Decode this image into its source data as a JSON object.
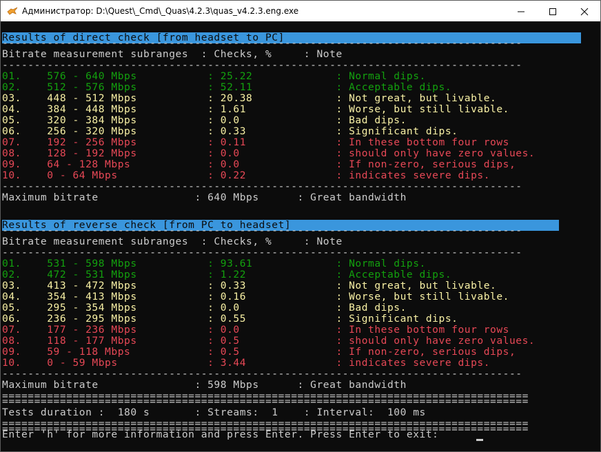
{
  "window": {
    "title": "Администратор: D:\\Quest\\_Cmd\\_Quas\\4.2.3\\quas_v4.2.3.eng.exe",
    "icon": "quas-app-icon",
    "controls": [
      "minimize-icon",
      "maximize-icon",
      "close-icon"
    ]
  },
  "colors": {
    "background": "#0c0c0c",
    "text": "#cccccc",
    "header_bar": "#3a96dd",
    "green": "#13a10e",
    "yellow": "#f9f1a5",
    "red": "#e74856"
  },
  "lines": {
    "dash": "---------------------------------------------------------------------------------",
    "equals": "=================================================================================="
  },
  "direct": {
    "header": "Results of direct check [from headset to PC]",
    "columns": "Bitrate measurement subranges  : Checks, %     : Note",
    "rows": [
      {
        "text": "01.    576 - 640 Mbps           : 25.22             : Normal dips.",
        "color": "green"
      },
      {
        "text": "02.    512 - 576 Mbps           : 52.11             : Acceptable dips.",
        "color": "green"
      },
      {
        "text": "03.    448 - 512 Mbps           : 20.38             : Not great, but livable.",
        "color": "yellow"
      },
      {
        "text": "04.    384 - 448 Mbps           : 1.61              : Worse, but still livable.",
        "color": "yellow"
      },
      {
        "text": "05.    320 - 384 Mbps           : 0.0               : Bad dips.",
        "color": "yellow"
      },
      {
        "text": "06.    256 - 320 Mbps           : 0.33              : Significant dips.",
        "color": "yellow"
      },
      {
        "text": "07.    192 - 256 Mbps           : 0.11              : In these bottom four rows",
        "color": "red"
      },
      {
        "text": "08.    128 - 192 Mbps           : 0.0               : should only have zero values.",
        "color": "red"
      },
      {
        "text": "09.    64 - 128 Mbps            : 0.0               : If non-zero, serious dips,",
        "color": "red"
      },
      {
        "text": "10.    0 - 64 Mbps              : 0.22              : indicates severe dips.",
        "color": "red"
      }
    ],
    "max": "Maximum bitrate               : 640 Mbps      : Great bandwidth"
  },
  "reverse": {
    "header": "Results of reverse check [from PC to headset]",
    "columns": "Bitrate measurement subranges  : Checks, %     : Note",
    "rows": [
      {
        "text": "01.    531 - 598 Mbps           : 93.61             : Normal dips.",
        "color": "green"
      },
      {
        "text": "02.    472 - 531 Mbps           : 1.22              : Acceptable dips.",
        "color": "green"
      },
      {
        "text": "03.    413 - 472 Mbps           : 0.33              : Not great, but livable.",
        "color": "yellow"
      },
      {
        "text": "04.    354 - 413 Mbps           : 0.16              : Worse, but still livable.",
        "color": "yellow"
      },
      {
        "text": "05.    295 - 354 Mbps           : 0.0               : Bad dips.",
        "color": "yellow"
      },
      {
        "text": "06.    236 - 295 Mbps           : 0.55              : Significant dips.",
        "color": "yellow"
      },
      {
        "text": "07.    177 - 236 Mbps           : 0.0               : In these bottom four rows",
        "color": "red"
      },
      {
        "text": "08.    118 - 177 Mbps           : 0.5               : should only have zero values.",
        "color": "red"
      },
      {
        "text": "09.    59 - 118 Mbps            : 0.5               : If non-zero, serious dips,",
        "color": "red"
      },
      {
        "text": "10.    0 - 59 Mbps              : 3.44              : indicates severe dips.",
        "color": "red"
      }
    ],
    "max": "Maximum bitrate               : 598 Mbps      : Great bandwidth"
  },
  "summary": "Tests duration :  180 s       : Streams:  1    : Interval:  100 ms",
  "prompt": "Enter 'h' for more information and press Enter. Press Enter to exit:"
}
